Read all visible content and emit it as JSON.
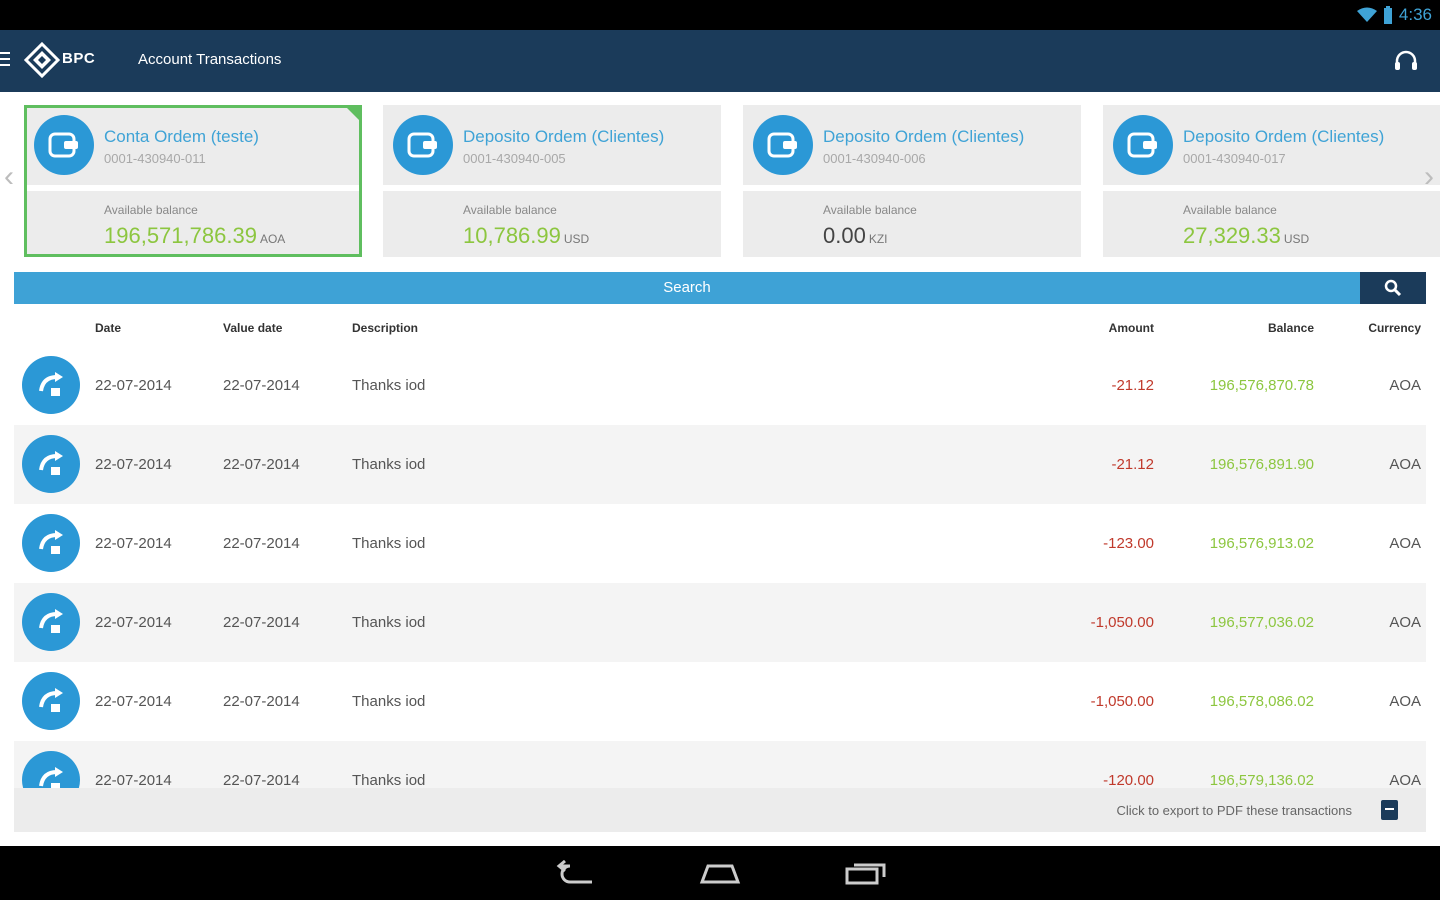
{
  "status_bar": {
    "time": "4:36"
  },
  "app_bar": {
    "logo_text": "BPC",
    "title": "Account Transactions"
  },
  "accounts": [
    {
      "name": "Conta Ordem (teste)",
      "number": "0001-430940-011",
      "available_label": "Available balance",
      "balance": "196,571,786.39",
      "currency": "AOA",
      "balance_color": "#8cc63f",
      "selected": true
    },
    {
      "name": "Deposito Ordem (Clientes)",
      "number": "0001-430940-005",
      "available_label": "Available balance",
      "balance": "10,786.99",
      "currency": "USD",
      "balance_color": "#8cc63f",
      "selected": false
    },
    {
      "name": "Deposito Ordem (Clientes)",
      "number": "0001-430940-006",
      "available_label": "Available balance",
      "balance": "0.00",
      "currency": "KZI",
      "balance_color": "#444444",
      "selected": false
    },
    {
      "name": "Deposito Ordem (Clientes)",
      "number": "0001-430940-017",
      "available_label": "Available balance",
      "balance": "27,329.33",
      "currency": "USD",
      "balance_color": "#8cc63f",
      "selected": false
    }
  ],
  "search": {
    "label": "Search"
  },
  "table": {
    "headers": {
      "date": "Date",
      "value_date": "Value date",
      "description": "Description",
      "amount": "Amount",
      "balance": "Balance",
      "currency": "Currency"
    },
    "rows": [
      {
        "date": "22-07-2014",
        "value_date": "22-07-2014",
        "description": "Thanks iod",
        "amount": "-21.12",
        "balance": "196,576,870.78",
        "currency": "AOA"
      },
      {
        "date": "22-07-2014",
        "value_date": "22-07-2014",
        "description": "Thanks iod",
        "amount": "-21.12",
        "balance": "196,576,891.90",
        "currency": "AOA"
      },
      {
        "date": "22-07-2014",
        "value_date": "22-07-2014",
        "description": "Thanks iod",
        "amount": "-123.00",
        "balance": "196,576,913.02",
        "currency": "AOA"
      },
      {
        "date": "22-07-2014",
        "value_date": "22-07-2014",
        "description": "Thanks iod",
        "amount": "-1,050.00",
        "balance": "196,577,036.02",
        "currency": "AOA"
      },
      {
        "date": "22-07-2014",
        "value_date": "22-07-2014",
        "description": "Thanks iod",
        "amount": "-1,050.00",
        "balance": "196,578,086.02",
        "currency": "AOA"
      },
      {
        "date": "22-07-2014",
        "value_date": "22-07-2014",
        "description": "Thanks iod",
        "amount": "-120.00",
        "balance": "196,579,136.02",
        "currency": "AOA"
      }
    ]
  },
  "footer": {
    "export_label": "Click to export to PDF these transactions"
  },
  "colors": {
    "primary_dark": "#1b3b5a",
    "accent_blue": "#3ea2d6",
    "positive_green": "#8cc63f",
    "negative_red": "#c0392b",
    "selected_border": "#5fbe5f"
  },
  "icons": {
    "menu": "hamburger-icon",
    "logo": "bpc-logo-icon",
    "support": "headset-icon",
    "account": "wallet-icon",
    "transaction": "transfer-icon",
    "search": "search-icon",
    "export": "pdf-icon",
    "back": "back-icon",
    "home": "home-icon",
    "recents": "recents-icon"
  }
}
